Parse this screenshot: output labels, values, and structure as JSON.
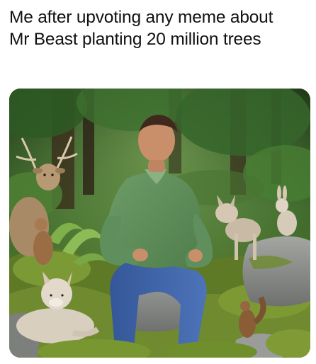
{
  "meme": {
    "caption_lines": [
      "Me after upvoting any meme about",
      "Mr Beast planting 20 million trees"
    ]
  },
  "photo": {
    "colors": {
      "forest_dark": "#223a1c",
      "forest_mid": "#3f6a2c",
      "moss": "#6f8a2f",
      "rock": "#8d8f8c",
      "shirt": "#5f8f5c",
      "jeans": "#3f62a8",
      "skin": "#c88f6a",
      "fur": "#cfc3b1"
    }
  }
}
